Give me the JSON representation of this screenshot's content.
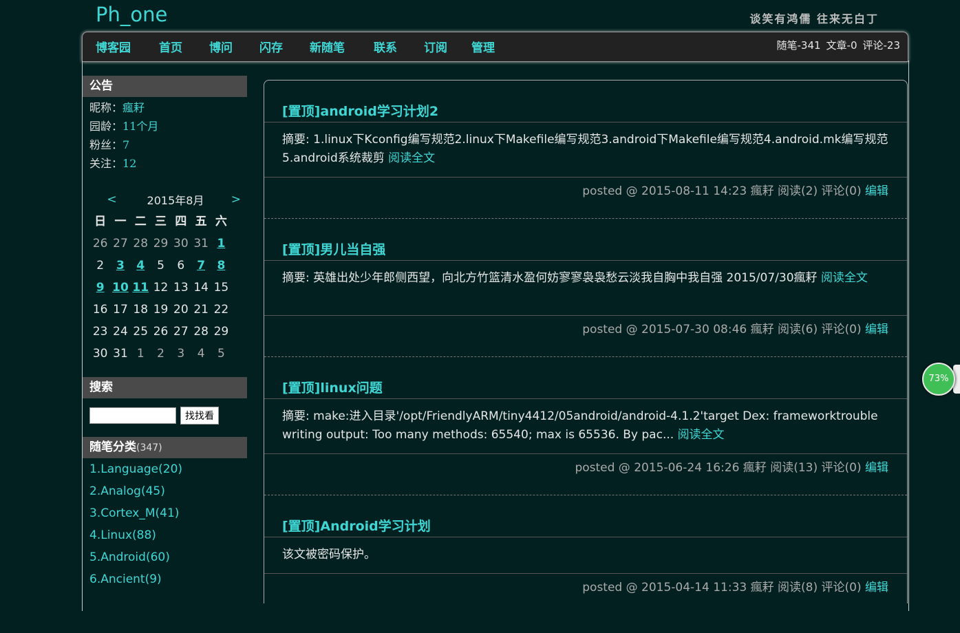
{
  "header": {
    "title": "Ph_one",
    "motto": "谈笑有鸿儒 往来无白丁"
  },
  "nav": {
    "items": [
      "博客园",
      "首页",
      "博问",
      "闪存",
      "新随笔",
      "联系",
      "订阅",
      "管理"
    ],
    "stats": [
      "随笔-341",
      "文章-0",
      "评论-23"
    ]
  },
  "notice": {
    "heading": "公告",
    "rows": [
      {
        "label": "昵称：",
        "value": "瘋耔"
      },
      {
        "label": "园龄：",
        "value": "11个月"
      },
      {
        "label": "粉丝：",
        "value": "7"
      },
      {
        "label": "关注：",
        "value": "12"
      }
    ]
  },
  "calendar": {
    "prev": "<",
    "title": "2015年8月",
    "next": ">",
    "dow": [
      "日",
      "一",
      "二",
      "三",
      "四",
      "五",
      "六"
    ],
    "cells": [
      {
        "d": "26",
        "t": "other"
      },
      {
        "d": "27",
        "t": "other"
      },
      {
        "d": "28",
        "t": "other"
      },
      {
        "d": "29",
        "t": "other"
      },
      {
        "d": "30",
        "t": "other"
      },
      {
        "d": "31",
        "t": "other"
      },
      {
        "d": "1",
        "t": "link"
      },
      {
        "d": "2",
        "t": ""
      },
      {
        "d": "3",
        "t": "link"
      },
      {
        "d": "4",
        "t": "link"
      },
      {
        "d": "5",
        "t": ""
      },
      {
        "d": "6",
        "t": ""
      },
      {
        "d": "7",
        "t": "link"
      },
      {
        "d": "8",
        "t": "link"
      },
      {
        "d": "9",
        "t": "link"
      },
      {
        "d": "10",
        "t": "link"
      },
      {
        "d": "11",
        "t": "link"
      },
      {
        "d": "12",
        "t": ""
      },
      {
        "d": "13",
        "t": ""
      },
      {
        "d": "14",
        "t": ""
      },
      {
        "d": "15",
        "t": ""
      },
      {
        "d": "16",
        "t": ""
      },
      {
        "d": "17",
        "t": ""
      },
      {
        "d": "18",
        "t": ""
      },
      {
        "d": "19",
        "t": ""
      },
      {
        "d": "20",
        "t": ""
      },
      {
        "d": "21",
        "t": ""
      },
      {
        "d": "22",
        "t": ""
      },
      {
        "d": "23",
        "t": ""
      },
      {
        "d": "24",
        "t": ""
      },
      {
        "d": "25",
        "t": ""
      },
      {
        "d": "26",
        "t": ""
      },
      {
        "d": "27",
        "t": ""
      },
      {
        "d": "28",
        "t": ""
      },
      {
        "d": "29",
        "t": ""
      },
      {
        "d": "30",
        "t": ""
      },
      {
        "d": "31",
        "t": ""
      },
      {
        "d": "1",
        "t": "other"
      },
      {
        "d": "2",
        "t": "other"
      },
      {
        "d": "3",
        "t": "other"
      },
      {
        "d": "4",
        "t": "other"
      },
      {
        "d": "5",
        "t": "other"
      }
    ]
  },
  "search": {
    "heading": "搜索",
    "button": "找找看"
  },
  "categories": {
    "heading": "随笔分类",
    "count": "(347)",
    "items": [
      "1.Language(20)",
      "2.Analog(45)",
      "3.Cortex_M(41)",
      "4.Linux(88)",
      "5.Android(60)",
      "6.Ancient(9)"
    ]
  },
  "posts": [
    {
      "title": "[置顶]android学习计划2",
      "summary": "摘要: 1.linux下Kconfig编写规范2.linux下Makefile编写规范3.android下Makefile编写规范4.android.mk编写规范5.android系统裁剪",
      "read_more": "阅读全文",
      "meta": "posted @ 2015-08-11 14:23 瘋耔 阅读(2) 评论(0)",
      "edit": "编辑"
    },
    {
      "title": "[置顶]男儿当自强",
      "summary": "摘要: 英雄出处少年郎侧西望，向北方竹篮清水盈何妨寥寥袅袅愁云淡我自胸中我自强 2015/07/30瘋耔",
      "read_more": "阅读全文",
      "meta": "posted @ 2015-07-30 08:46 瘋耔 阅读(6) 评论(0)",
      "edit": "编辑"
    },
    {
      "title": "[置顶]linux问题",
      "summary": "摘要: make:进入目录'/opt/FriendlyARM/tiny4412/05android/android-4.1.2'target Dex: frameworktrouble writing output: Too many methods: 65540; max is 65536. By pac...",
      "read_more": "阅读全文",
      "meta": "posted @ 2015-06-24 16:26 瘋耔 阅读(13) 评论(0)",
      "edit": "编辑"
    },
    {
      "title": "[置顶]Android学习计划",
      "summary": "该文被密码保护。",
      "read_more": "",
      "meta": "posted @ 2015-04-14 11:33 瘋耔 阅读(8) 评论(0)",
      "edit": "编辑"
    }
  ],
  "badge": {
    "label": "73%",
    "color": "#3fbf55"
  },
  "colors": {
    "accent": "#3fd6d4",
    "background": "#032020"
  }
}
